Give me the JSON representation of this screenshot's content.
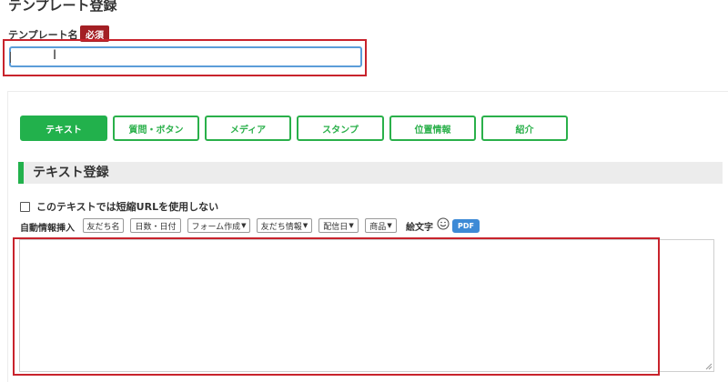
{
  "page": {
    "title": "テンプレート登録"
  },
  "template_name": {
    "label": "テンプレート名",
    "required_badge": "必須",
    "value": "",
    "placeholder": ""
  },
  "tabs": [
    {
      "label": "テキスト",
      "active": true
    },
    {
      "label": "質問・ボタン",
      "active": false
    },
    {
      "label": "メディア",
      "active": false
    },
    {
      "label": "スタンプ",
      "active": false
    },
    {
      "label": "位置情報",
      "active": false
    },
    {
      "label": "紹介",
      "active": false
    }
  ],
  "section": {
    "title": "テキスト登録"
  },
  "short_url": {
    "label": "このテキストでは短縮URLを使用しない",
    "checked": false
  },
  "auto_insert": {
    "label": "自動情報挿入",
    "buttons": [
      {
        "label": "友だち名"
      },
      {
        "label": "日数・日付"
      },
      {
        "label": "フォーム作成"
      },
      {
        "label": "友だち情報"
      },
      {
        "label": "配信日"
      },
      {
        "label": "商品"
      }
    ],
    "emoji_label": "絵文字",
    "pdf_label": "PDF"
  },
  "message": {
    "value": ""
  },
  "colors": {
    "accent_green": "#22b14c",
    "highlight_red": "#c8232c",
    "badge_red": "#a31f24",
    "pdf_blue": "#3d8ad6"
  }
}
